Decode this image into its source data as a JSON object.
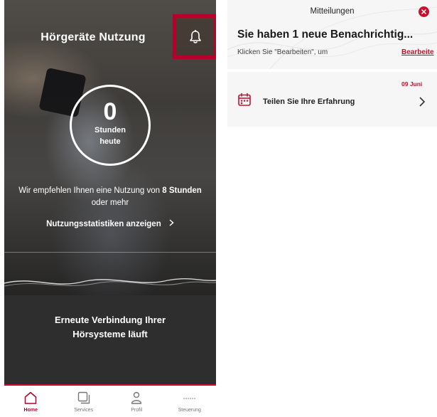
{
  "home": {
    "title": "Hörgeräte Nutzung",
    "usage_value": "0",
    "usage_unit_line1": "Stunden",
    "usage_unit_line2": "heute",
    "recommend_prefix": "Wir empfehlen Ihnen eine Nutzung von ",
    "recommend_hours": "8",
    "recommend_unit": "Stunden",
    "recommend_suffix": " oder mehr",
    "stats_link": "Nutzungsstatistiken anzeigen",
    "reconnect_line1": "Erneute Verbindung Ihrer",
    "reconnect_line2": "Hörsysteme läuft"
  },
  "tabbar": {
    "items": [
      {
        "label": "Home",
        "icon": "home-icon"
      },
      {
        "label": "Services",
        "icon": "services-icon"
      },
      {
        "label": "Profil",
        "icon": "profile-icon"
      },
      {
        "label": "Steuerung",
        "icon": "controls-icon"
      }
    ],
    "active_index": 0
  },
  "notifications": {
    "topbar_title": "Mitteilungen",
    "headline": "Sie haben 1 neue Benachrichtig...",
    "subtitle": "Klicken Sie \"Bearbeiten\", um",
    "edit_label": "Bearbeite",
    "items": [
      {
        "date": "09 Juni",
        "text": "Teilen Sie Ihre Erfahrung",
        "icon": "calendar-icon"
      }
    ]
  },
  "colors": {
    "accent": "#c8102e",
    "highlight_border": "#b5002a",
    "dark_panel": "#2e2e2e",
    "header_bg": "#f6f6f6"
  }
}
